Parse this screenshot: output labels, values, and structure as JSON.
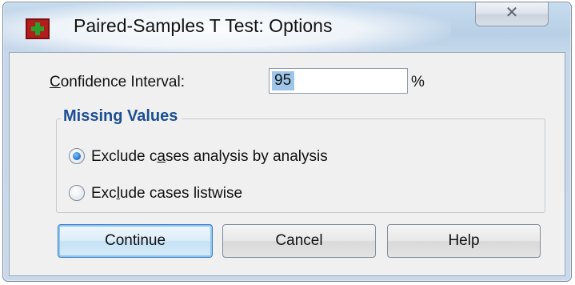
{
  "window": {
    "title": "Paired-Samples T Test: Options",
    "close_glyph": "✕",
    "app_icon": "spss-grid-icon"
  },
  "confidence": {
    "label_prefix": "C",
    "label_rest": "onfidence Interval:",
    "value": "95",
    "unit": "%"
  },
  "missing_values": {
    "legend": "Missing Values",
    "options": [
      {
        "pre": "Exclude c",
        "mn": "a",
        "post": "ses analysis by analysis",
        "selected": true
      },
      {
        "pre": "Exc",
        "mn": "l",
        "post": "ude cases listwise",
        "selected": false
      }
    ]
  },
  "buttons": {
    "continue": "Continue",
    "cancel": "Cancel",
    "help": "Help"
  },
  "colors": {
    "legend_blue": "#1c4f93",
    "selection_blue": "#9fc6e8",
    "radio_selected": "#1e6fc8"
  }
}
